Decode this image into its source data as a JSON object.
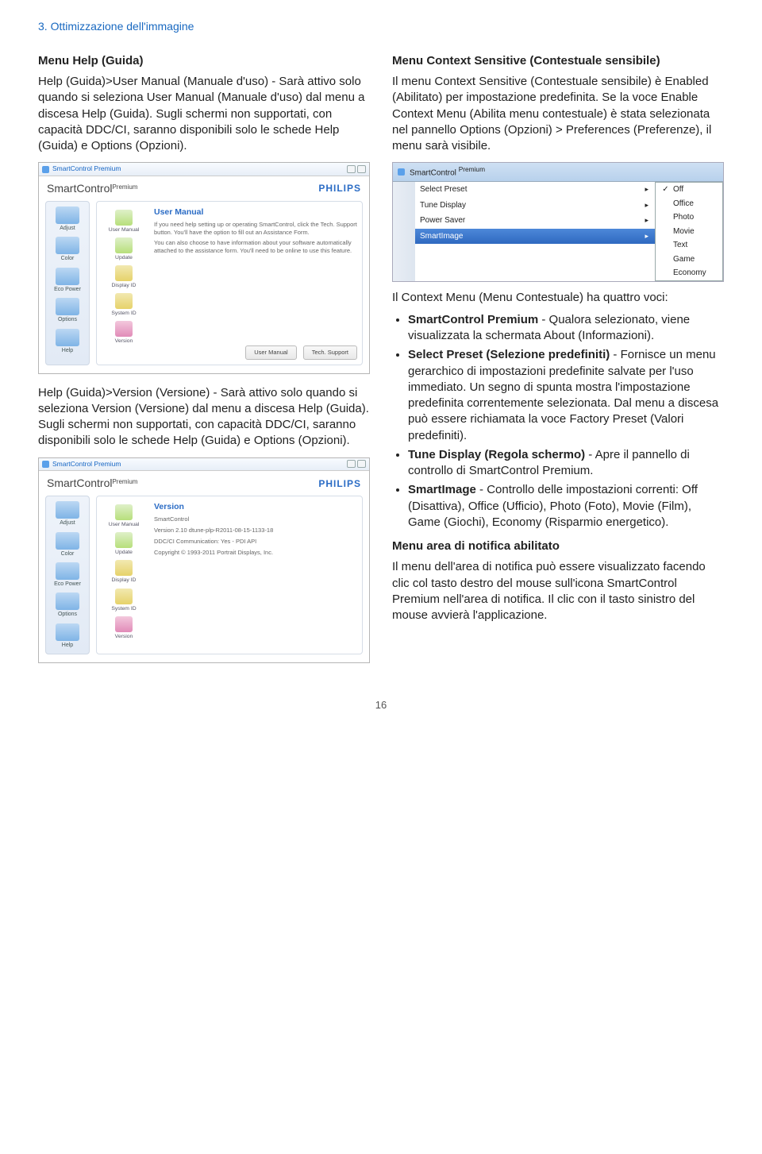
{
  "crumb": "3. Ottimizzazione dell'immagine",
  "left": {
    "h1": "Menu Help (Guida)",
    "p1": "Help (Guida)>User Manual (Manuale d'uso) - Sarà attivo solo quando si seleziona User Manual (Manuale d'uso) dal menu a discesa Help (Guida). Sugli schermi non supportati, con capacità DDC/CI, saranno disponibili solo le schede Help (Guida) e Options (Opzioni).",
    "p2": "Help (Guida)>Version (Versione) - Sarà attivo solo quando si seleziona Version (Versione) dal menu a discesa Help (Guida). Sugli schermi non supportati, con capacità DDC/CI, saranno disponibili solo le schede Help (Guida) e Options (Opzioni)."
  },
  "right": {
    "h1": "Menu Context Sensitive (Contestuale sensibile)",
    "p1": "Il menu Context Sensitive (Contestuale sensibile) è Enabled (Abilitato) per impostazione predefinita. Se la voce Enable Context Menu (Abilita menu contestuale) è stata selezionata nel pannello Options (Opzioni) > Preferences (Preferenze), il menu sarà visibile.",
    "p2": "Il Context Menu (Menu Contestuale) ha quattro voci:",
    "li1b": "SmartControl Premium",
    "li1": " - Qualora selezionato, viene visualizzata la schermata About (Informazioni).",
    "li2b": "Select Preset (Selezione predefiniti)",
    "li2": " - Fornisce un menu gerarchico di impostazioni predefinite salvate per l'uso immediato. Un segno di spunta mostra l'impostazione predefinita correntemente selezionata. Dal menu a discesa può essere richiamata la voce Factory Preset (Valori predefiniti).",
    "li3b": "Tune Display (Regola schermo)",
    "li3": " - Apre il pannello di controllo di SmartControl Premium.",
    "li4b": "SmartImage",
    "li4": " - Controllo delle impostazioni correnti: Off (Disattiva), Office (Ufficio), Photo (Foto), Movie (Film), Game (Giochi), Economy (Risparmio energetico).",
    "h2": "Menu area di notifica abilitato",
    "p3": "Il menu dell'area di notifica può essere visualizzato facendo clic col tasto destro del mouse sull'icona SmartControl Premium nell'area di notifica. Il clic con il tasto sinistro del mouse avvierà l'applicazione."
  },
  "dlg": {
    "title": "SmartControl Premium",
    "appName": "SmartControl",
    "appSup": "Premium",
    "brand": "PHILIPS",
    "side": {
      "adjust": "Adjust",
      "color": "Color",
      "eco": "Eco Power",
      "options": "Options",
      "help": "Help"
    },
    "main1": {
      "title": "User Manual",
      "p1": "If you need help setting up or operating SmartControl, click the Tech. Support button. You'll have the option to fill out an Assistance Form.",
      "p2": "You can also choose to have information about your software automatically attached to the assistance form. You'll need to be online to use this feature.",
      "icons": {
        "um": "User Manual",
        "up": "Update",
        "did": "Display ID",
        "sid": "System ID",
        "ver": "Version"
      },
      "btn1": "User Manual",
      "btn2": "Tech. Support"
    },
    "main2": {
      "title": "Version",
      "l1": "SmartControl",
      "l2": "Version 2.10   dtune-plp-R2011-08-15-1133-18",
      "l3": "DDC/CI Communication: Yes - PDI API",
      "l4": "Copyright © 1993-2011 Portrait Displays, Inc."
    }
  },
  "cm": {
    "topLabel": "SmartControl",
    "topBadgeSup": "Premium",
    "items": {
      "sp": "Select Preset",
      "td": "Tune Display",
      "ps": "Power Saver",
      "si": "SmartImage"
    },
    "sub": {
      "off": "Off",
      "office": "Office",
      "photo": "Photo",
      "movie": "Movie",
      "text": "Text",
      "game": "Game",
      "eco": "Economy"
    }
  },
  "page": "16"
}
